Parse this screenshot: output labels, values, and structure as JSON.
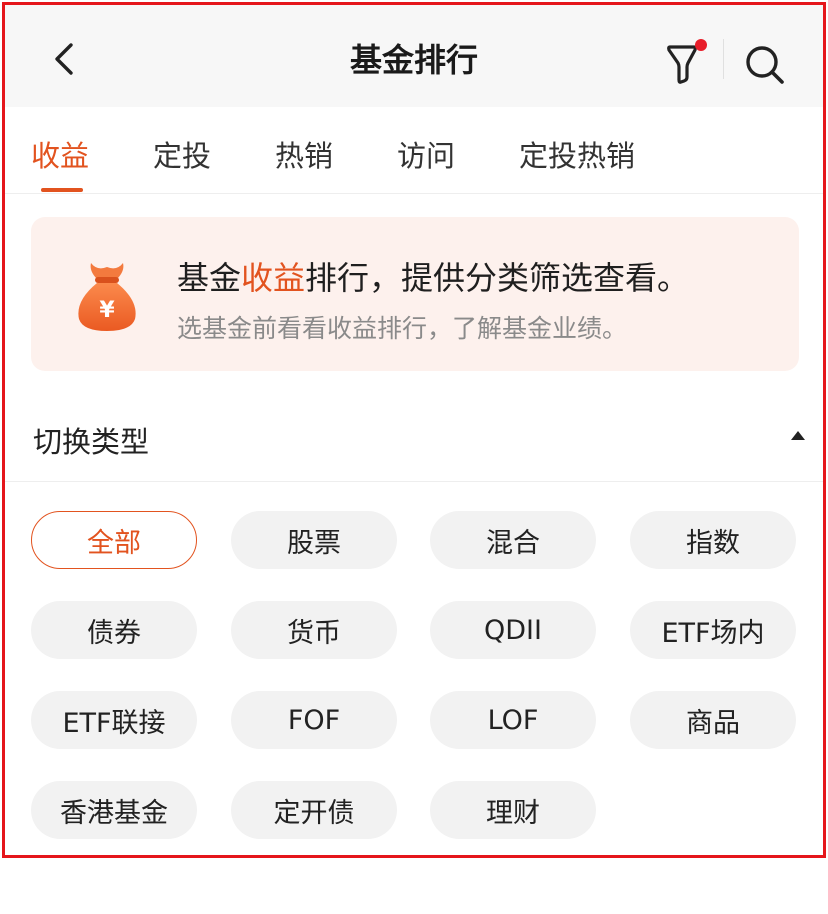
{
  "header": {
    "title": "基金排行",
    "back_icon": "chevron-left-icon",
    "filter_icon": "filter-icon",
    "search_icon": "search-icon",
    "badge_color": "#e81e2a"
  },
  "tabs": [
    {
      "label": "收益",
      "active": true
    },
    {
      "label": "定投"
    },
    {
      "label": "热销"
    },
    {
      "label": "访问"
    },
    {
      "label": "定投热销"
    }
  ],
  "banner": {
    "line1_prefix": "基金",
    "line1_highlight": "收益",
    "line1_suffix": "排行，提供分类筛选查看。",
    "line2": "选基金前看看收益排行，了解基金业绩。",
    "icon": "money-bag-icon",
    "currency_symbol": "¥"
  },
  "type_section": {
    "title": "切换类型",
    "toggle_icon": "caret-up-icon"
  },
  "types": [
    {
      "label": "全部",
      "selected": true
    },
    {
      "label": "股票"
    },
    {
      "label": "混合"
    },
    {
      "label": "指数"
    },
    {
      "label": "债券"
    },
    {
      "label": "货币"
    },
    {
      "label": "QDII"
    },
    {
      "label": "ETF场内"
    },
    {
      "label": "ETF联接"
    },
    {
      "label": "FOF"
    },
    {
      "label": "LOF"
    },
    {
      "label": "商品"
    },
    {
      "label": "香港基金"
    },
    {
      "label": "定开债"
    },
    {
      "label": "理财"
    }
  ],
  "colors": {
    "accent": "#e2531f",
    "frame_border": "#e5161b",
    "banner_bg": "#fdf1ed"
  }
}
